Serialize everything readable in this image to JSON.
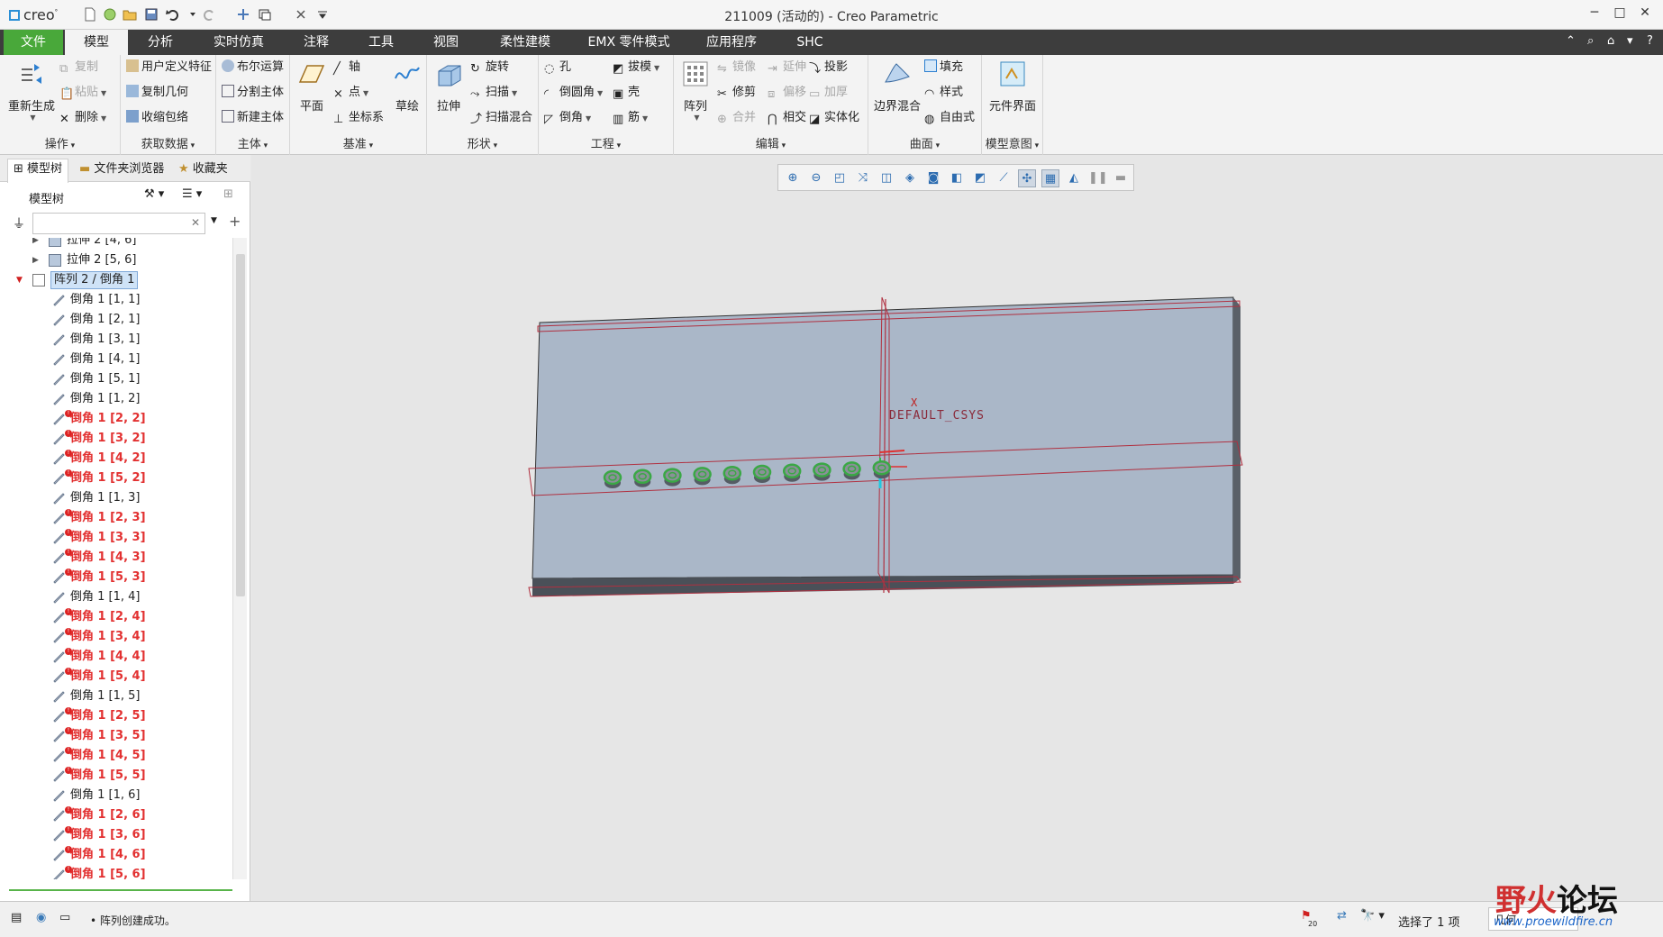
{
  "app": {
    "logo": "creo",
    "window_title": "211009 (活动的) - Creo Parametric"
  },
  "tabs": [
    {
      "label": "文件"
    },
    {
      "label": "模型"
    },
    {
      "label": "分析"
    },
    {
      "label": "实时仿真"
    },
    {
      "label": "注释"
    },
    {
      "label": "工具"
    },
    {
      "label": "视图"
    },
    {
      "label": "柔性建模"
    },
    {
      "label": "EMX 零件模式"
    },
    {
      "label": "应用程序"
    },
    {
      "label": "SHC"
    }
  ],
  "ribbon": {
    "groups": [
      {
        "label": "操作",
        "items": [
          "重新生成",
          "复制",
          "粘贴",
          "删除"
        ]
      },
      {
        "label": "获取数据",
        "items": [
          "用户定义特征",
          "复制几何",
          "收缩包络"
        ]
      },
      {
        "label": "主体",
        "items": [
          "布尔运算",
          "分割主体",
          "新建主体"
        ]
      },
      {
        "label": "基准",
        "items": [
          "平面",
          "轴",
          "点",
          "坐标系",
          "草绘"
        ]
      },
      {
        "label": "形状",
        "items": [
          "拉伸",
          "旋转",
          "扫描",
          "扫描混合"
        ]
      },
      {
        "label": "工程",
        "items": [
          "孔",
          "拔模",
          "倒圆角",
          "壳",
          "倒角",
          "筋"
        ]
      },
      {
        "label": "编辑",
        "items": [
          "阵列",
          "镜像",
          "延伸",
          "投影",
          "修剪",
          "偏移",
          "加厚",
          "合并",
          "相交",
          "实体化"
        ]
      },
      {
        "label": "曲面",
        "items": [
          "边界混合",
          "填充",
          "样式",
          "自由式"
        ]
      },
      {
        "label": "模型意图",
        "items": [
          "元件界面"
        ]
      }
    ]
  },
  "panel": {
    "tabs": [
      "模型树",
      "文件夹浏览器",
      "收藏夹"
    ],
    "tree_header": "模型树",
    "search_value": ""
  },
  "tree": [
    {
      "text": "拉伸 2 [4, 6]",
      "level": 1,
      "type": "extrude",
      "expand": "▶"
    },
    {
      "text": "拉伸 2 [5, 6]",
      "level": 1,
      "type": "extrude",
      "expand": "▶"
    },
    {
      "text": "阵列 2 / 倒角 1",
      "level": 0,
      "type": "pattern",
      "expand": "▼",
      "selected": true
    },
    {
      "text": "倒角 1 [1, 1]",
      "level": 2,
      "type": "chamfer"
    },
    {
      "text": "倒角 1 [2, 1]",
      "level": 2,
      "type": "chamfer"
    },
    {
      "text": "倒角 1 [3, 1]",
      "level": 2,
      "type": "chamfer"
    },
    {
      "text": "倒角 1 [4, 1]",
      "level": 2,
      "type": "chamfer"
    },
    {
      "text": "倒角 1 [5, 1]",
      "level": 2,
      "type": "chamfer"
    },
    {
      "text": "倒角 1 [1, 2]",
      "level": 2,
      "type": "chamfer"
    },
    {
      "text": "倒角 1 [2, 2]",
      "level": 2,
      "type": "chamfer",
      "error": true
    },
    {
      "text": "倒角 1 [3, 2]",
      "level": 2,
      "type": "chamfer",
      "error": true
    },
    {
      "text": "倒角 1 [4, 2]",
      "level": 2,
      "type": "chamfer",
      "error": true
    },
    {
      "text": "倒角 1 [5, 2]",
      "level": 2,
      "type": "chamfer",
      "error": true
    },
    {
      "text": "倒角 1 [1, 3]",
      "level": 2,
      "type": "chamfer"
    },
    {
      "text": "倒角 1 [2, 3]",
      "level": 2,
      "type": "chamfer",
      "error": true
    },
    {
      "text": "倒角 1 [3, 3]",
      "level": 2,
      "type": "chamfer",
      "error": true
    },
    {
      "text": "倒角 1 [4, 3]",
      "level": 2,
      "type": "chamfer",
      "error": true
    },
    {
      "text": "倒角 1 [5, 3]",
      "level": 2,
      "type": "chamfer",
      "error": true
    },
    {
      "text": "倒角 1 [1, 4]",
      "level": 2,
      "type": "chamfer"
    },
    {
      "text": "倒角 1 [2, 4]",
      "level": 2,
      "type": "chamfer",
      "error": true
    },
    {
      "text": "倒角 1 [3, 4]",
      "level": 2,
      "type": "chamfer",
      "error": true
    },
    {
      "text": "倒角 1 [4, 4]",
      "level": 2,
      "type": "chamfer",
      "error": true
    },
    {
      "text": "倒角 1 [5, 4]",
      "level": 2,
      "type": "chamfer",
      "error": true
    },
    {
      "text": "倒角 1 [1, 5]",
      "level": 2,
      "type": "chamfer"
    },
    {
      "text": "倒角 1 [2, 5]",
      "level": 2,
      "type": "chamfer",
      "error": true
    },
    {
      "text": "倒角 1 [3, 5]",
      "level": 2,
      "type": "chamfer",
      "error": true
    },
    {
      "text": "倒角 1 [4, 5]",
      "level": 2,
      "type": "chamfer",
      "error": true
    },
    {
      "text": "倒角 1 [5, 5]",
      "level": 2,
      "type": "chamfer",
      "error": true
    },
    {
      "text": "倒角 1 [1, 6]",
      "level": 2,
      "type": "chamfer"
    },
    {
      "text": "倒角 1 [2, 6]",
      "level": 2,
      "type": "chamfer",
      "error": true
    },
    {
      "text": "倒角 1 [3, 6]",
      "level": 2,
      "type": "chamfer",
      "error": true
    },
    {
      "text": "倒角 1 [4, 6]",
      "level": 2,
      "type": "chamfer",
      "error": true
    },
    {
      "text": "倒角 1 [5, 6]",
      "level": 2,
      "type": "chamfer",
      "error": true
    }
  ],
  "viewport": {
    "csys_label": "DEFAULT_CSYS",
    "x_axis_label": "X",
    "feature_count_visible": 10
  },
  "status": {
    "message": "• 阵列创建成功。",
    "selection": "选择了 1 项",
    "filter": "几何",
    "flag_count": "20"
  },
  "watermark": {
    "text_red": "野火",
    "text_black": "论坛",
    "url": "www.proewildfire.cn"
  },
  "colors": {
    "file_tab": "#49a83a",
    "tab_strip": "#3d3d3d",
    "error_text": "#e23030",
    "part_face": "#aab7c8",
    "feature_green": "#3aa845"
  }
}
